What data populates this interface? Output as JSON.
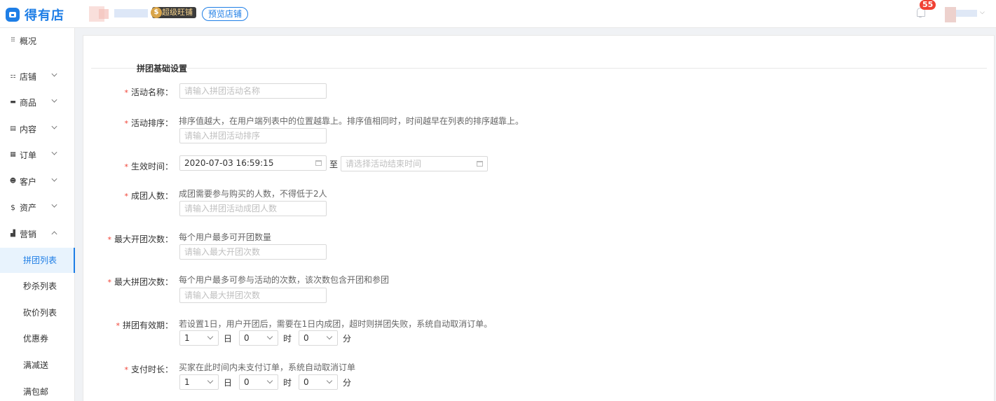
{
  "header": {
    "logo_text": "得有店",
    "vip_badge": "超级旺铺",
    "vip_coin": "$",
    "preview_button": "预览店铺",
    "notification_count": "55"
  },
  "sidebar": {
    "items": [
      {
        "label": "概况",
        "icon": "grid-icon"
      },
      {
        "label": "店铺",
        "icon": "shop-icon"
      },
      {
        "label": "商品",
        "icon": "goods-icon"
      },
      {
        "label": "内容",
        "icon": "content-icon"
      },
      {
        "label": "订单",
        "icon": "order-icon"
      },
      {
        "label": "客户",
        "icon": "customer-icon"
      },
      {
        "label": "资产",
        "icon": "dollar-icon"
      },
      {
        "label": "营销",
        "icon": "chart-icon"
      }
    ],
    "marketing_sub": [
      "拼团列表",
      "秒杀列表",
      "砍价列表",
      "优惠券",
      "满减送",
      "满包邮"
    ],
    "active_sub": "拼团列表"
  },
  "form": {
    "section_title": "拼团基础设置",
    "activity_name": {
      "label": "活动名称：",
      "placeholder": "请输入拼团活动名称"
    },
    "activity_sort": {
      "label": "活动排序：",
      "hint": "排序值越大，在用户端列表中的位置越靠上。排序值相同时，时间越早在列表的排序越靠上。",
      "placeholder": "请输入拼团活动排序"
    },
    "effective_time": {
      "label": "生效时间：",
      "start_value": "2020-07-03 16:59:15",
      "to": "至",
      "end_placeholder": "请选择活动结束时间"
    },
    "group_size": {
      "label": "成团人数：",
      "hint": "成团需要参与购买的人数，不得低于2人",
      "placeholder": "请输入拼团活动成团人数"
    },
    "max_open": {
      "label": "最大开团次数：",
      "hint": "每个用户最多可开团数量",
      "placeholder": "请输入最大开团次数"
    },
    "max_join": {
      "label": "最大拼团次数：",
      "hint": "每个用户最多可参与活动的次数，该次数包含开团和参团",
      "placeholder": "请输入最大拼团次数"
    },
    "validity": {
      "label": "拼团有效期：",
      "hint": "若设置1日，用户开团后，需要在1日内成团，超时则拼团失败，系统自动取消订单。",
      "day": "1",
      "hour": "0",
      "minute": "0"
    },
    "pay_time": {
      "label": "支付时长：",
      "hint": "买家在此时间内未支付订单，系统自动取消订单",
      "day": "1",
      "hour": "0",
      "minute": "0"
    },
    "units": {
      "day": "日",
      "hour": "时",
      "minute": "分"
    },
    "required_mark": "*"
  }
}
